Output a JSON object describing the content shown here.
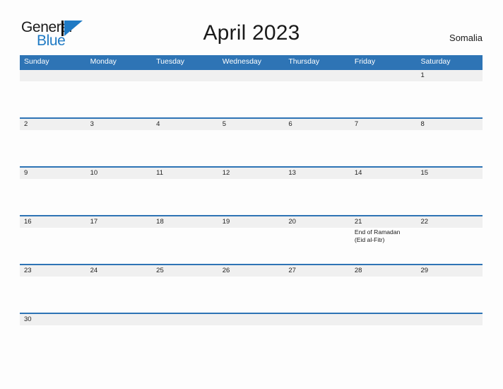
{
  "brand": {
    "name_part1": "General",
    "name_part2": "Blue",
    "mark": "triangle-logo",
    "accent_color": "#1f7ac4"
  },
  "header": {
    "title": "April 2023",
    "country": "Somalia"
  },
  "calendar": {
    "header_color": "#2e74b5",
    "date_strip_color": "#f0f0f0",
    "day_names": [
      "Sunday",
      "Monday",
      "Tuesday",
      "Wednesday",
      "Thursday",
      "Friday",
      "Saturday"
    ],
    "weeks": [
      {
        "days": [
          {
            "date": "",
            "event": ""
          },
          {
            "date": "",
            "event": ""
          },
          {
            "date": "",
            "event": ""
          },
          {
            "date": "",
            "event": ""
          },
          {
            "date": "",
            "event": ""
          },
          {
            "date": "",
            "event": ""
          },
          {
            "date": "1",
            "event": ""
          }
        ]
      },
      {
        "days": [
          {
            "date": "2",
            "event": ""
          },
          {
            "date": "3",
            "event": ""
          },
          {
            "date": "4",
            "event": ""
          },
          {
            "date": "5",
            "event": ""
          },
          {
            "date": "6",
            "event": ""
          },
          {
            "date": "7",
            "event": ""
          },
          {
            "date": "8",
            "event": ""
          }
        ]
      },
      {
        "days": [
          {
            "date": "9",
            "event": ""
          },
          {
            "date": "10",
            "event": ""
          },
          {
            "date": "11",
            "event": ""
          },
          {
            "date": "12",
            "event": ""
          },
          {
            "date": "13",
            "event": ""
          },
          {
            "date": "14",
            "event": ""
          },
          {
            "date": "15",
            "event": ""
          }
        ]
      },
      {
        "days": [
          {
            "date": "16",
            "event": ""
          },
          {
            "date": "17",
            "event": ""
          },
          {
            "date": "18",
            "event": ""
          },
          {
            "date": "19",
            "event": ""
          },
          {
            "date": "20",
            "event": ""
          },
          {
            "date": "21",
            "event": "End of Ramadan\n(Eid al-Fitr)"
          },
          {
            "date": "22",
            "event": ""
          }
        ]
      },
      {
        "days": [
          {
            "date": "23",
            "event": ""
          },
          {
            "date": "24",
            "event": ""
          },
          {
            "date": "25",
            "event": ""
          },
          {
            "date": "26",
            "event": ""
          },
          {
            "date": "27",
            "event": ""
          },
          {
            "date": "28",
            "event": ""
          },
          {
            "date": "29",
            "event": ""
          }
        ]
      },
      {
        "days": [
          {
            "date": "30",
            "event": ""
          },
          {
            "date": "",
            "event": ""
          },
          {
            "date": "",
            "event": ""
          },
          {
            "date": "",
            "event": ""
          },
          {
            "date": "",
            "event": ""
          },
          {
            "date": "",
            "event": ""
          },
          {
            "date": "",
            "event": ""
          }
        ]
      }
    ]
  }
}
